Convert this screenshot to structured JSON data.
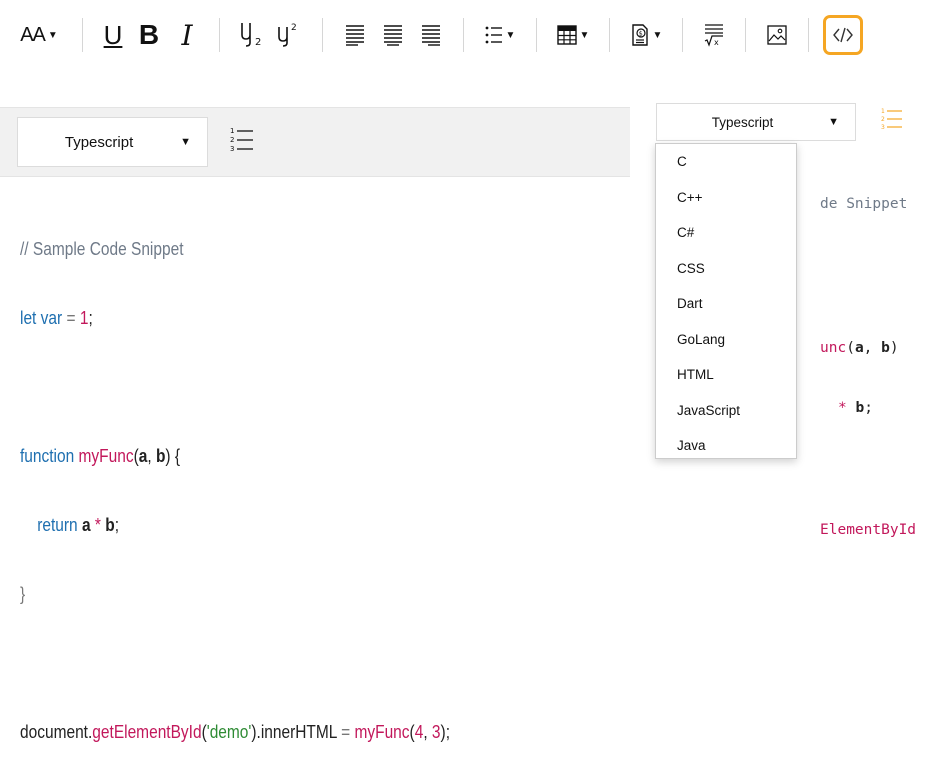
{
  "toolbar": {
    "font_size_label": "AA",
    "bold_label": "B",
    "italic_label": "I",
    "underline_label": "U",
    "icons": [
      "font-size-icon",
      "underline-icon",
      "bold-icon",
      "italic-icon",
      "subscript-icon",
      "superscript-icon",
      "align-left-icon",
      "align-center-icon",
      "align-right-icon",
      "list-icon",
      "table-icon",
      "insert-template-icon",
      "formula-icon",
      "image-icon",
      "code-block-icon"
    ]
  },
  "left_editor": {
    "language_label": "Typescript",
    "code_lines": [
      "// Sample Code Snippet",
      "let var = 1;",
      "",
      "function myFunc(a, b) {",
      "    return a * b;",
      "}",
      "",
      "document.getElementById('demo').innerHTML = myFunc(4, 3);"
    ]
  },
  "right_editor": {
    "language_label": "Typescript",
    "code_fragments": [
      "de Snippet",
      "unc(a, b)",
      "* b;",
      "ElementById"
    ]
  },
  "dropdown": {
    "options": [
      "C",
      "C++",
      "C#",
      "CSS",
      "Dart",
      "GoLang",
      "HTML",
      "JavaScript",
      "Java"
    ]
  },
  "colors": {
    "accent_highlight": "#f5a623",
    "keyword": "#1e6fb0",
    "function": "#c2185b",
    "string": "#2e8b34",
    "comment": "#6f7a88"
  }
}
